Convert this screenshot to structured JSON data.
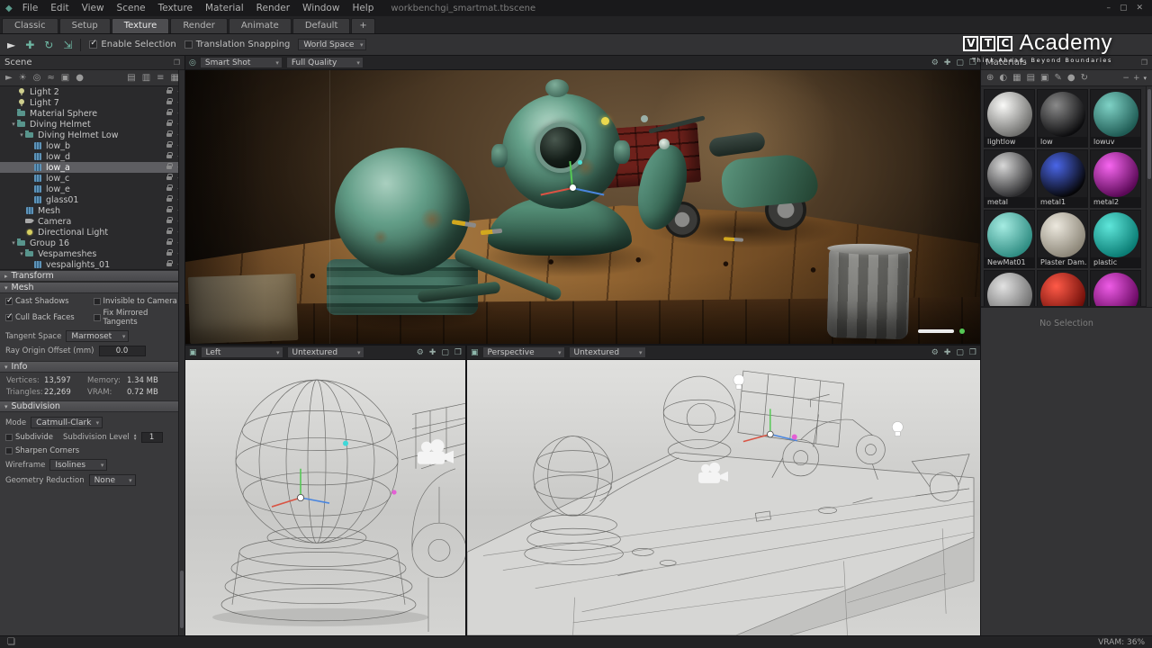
{
  "icons": {
    "app_logo": "◆",
    "camera": "◎",
    "viewport_screen": "▣",
    "performance": "❏",
    "expand_panel": "❐"
  },
  "titlebar": {
    "menus": [
      "File",
      "Edit",
      "View",
      "Scene",
      "Texture",
      "Material",
      "Render",
      "Window",
      "Help"
    ],
    "scene_file": "workbenchgi_smartmat.tbscene",
    "window_controls": [
      {
        "name": "minimize",
        "glyph": "–"
      },
      {
        "name": "maximize",
        "glyph": "▢"
      },
      {
        "name": "close",
        "glyph": "✕"
      }
    ]
  },
  "tabbar": {
    "tabs": [
      "Classic",
      "Setup",
      "Texture",
      "Render",
      "Animate",
      "Default",
      "+"
    ],
    "active": "Texture"
  },
  "toolbar": {
    "tools": [
      {
        "name": "select-tool",
        "glyph": "►"
      },
      {
        "name": "move-tool",
        "glyph": "✚"
      },
      {
        "name": "rotate-tool",
        "glyph": "↻"
      },
      {
        "name": "scale-tool",
        "glyph": "⇲"
      }
    ],
    "enable_selection_label": "Enable Selection",
    "translation_snapping_label": "Translation Snapping",
    "world_space_label": "World Space"
  },
  "brand": {
    "letters": [
      "V",
      "T",
      "C"
    ],
    "name": "Academy",
    "tagline": "Think Ahead, Beyond Boundaries"
  },
  "scene_panel": {
    "title": "Scene",
    "toolbar_left": [
      {
        "name": "select-object",
        "glyph": "►"
      },
      {
        "name": "add-light",
        "glyph": "☀"
      },
      {
        "name": "add-camera",
        "glyph": "◎"
      },
      {
        "name": "add-fog",
        "glyph": "≈"
      },
      {
        "name": "add-object",
        "glyph": "▣"
      },
      {
        "name": "add-sphere",
        "glyph": "●"
      }
    ],
    "toolbar_right": [
      {
        "name": "new-folder",
        "glyph": "▤"
      },
      {
        "name": "delete-item",
        "glyph": "▥"
      },
      {
        "name": "list-view",
        "glyph": "≡"
      },
      {
        "name": "grid-view",
        "glyph": "▦"
      }
    ],
    "tree": [
      {
        "label": "Light 2",
        "depth": 1,
        "icon": "light"
      },
      {
        "label": "Light 7",
        "depth": 1,
        "icon": "light"
      },
      {
        "label": "Material Sphere",
        "depth": 1,
        "icon": "folder"
      },
      {
        "label": "Diving Helmet",
        "depth": 1,
        "icon": "folder",
        "exp": true
      },
      {
        "label": "Diving Helmet Low",
        "depth": 2,
        "icon": "folder",
        "exp": true
      },
      {
        "label": "low_b",
        "depth": 3,
        "icon": "mesh"
      },
      {
        "label": "low_d",
        "depth": 3,
        "icon": "mesh"
      },
      {
        "label": "low_a",
        "depth": 3,
        "icon": "mesh",
        "selected": true
      },
      {
        "label": "low_c",
        "depth": 3,
        "icon": "mesh"
      },
      {
        "label": "low_e",
        "depth": 3,
        "icon": "mesh"
      },
      {
        "label": "glass01",
        "depth": 3,
        "icon": "mesh"
      },
      {
        "label": "Mesh",
        "depth": 2,
        "icon": "mesh"
      },
      {
        "label": "Camera",
        "depth": 2,
        "icon": "camera"
      },
      {
        "label": "Directional Light",
        "depth": 2,
        "icon": "dirlight"
      },
      {
        "label": "Group 16",
        "depth": 1,
        "icon": "folder",
        "exp": true
      },
      {
        "label": "Vespameshes",
        "depth": 2,
        "icon": "folder",
        "exp": true
      },
      {
        "label": "vespalights_01",
        "depth": 3,
        "icon": "mesh"
      }
    ]
  },
  "transform_section": {
    "title": "Transform"
  },
  "mesh_section": {
    "title": "Mesh",
    "options": [
      {
        "label": "Cast Shadows",
        "checked": true
      },
      {
        "label": "Invisible to Camera",
        "checked": false
      },
      {
        "label": "Cull Back Faces",
        "checked": true
      },
      {
        "label": "Fix Mirrored Tangents",
        "checked": false
      }
    ],
    "tangent_label": "Tangent Space",
    "tangent_value": "Marmoset",
    "ray_label": "Ray Origin Offset (mm)",
    "ray_value": "0.0"
  },
  "info_section": {
    "title": "Info",
    "rows": [
      {
        "k1": "Vertices:",
        "v1": "13,597",
        "k2": "Memory:",
        "v2": "1.34 MB"
      },
      {
        "k1": "Triangles:",
        "v1": "22,269",
        "k2": "VRAM:",
        "v2": "0.72 MB"
      }
    ]
  },
  "subdivision_section": {
    "title": "Subdivision",
    "mode_label": "Mode",
    "mode_value": "Catmull-Clark",
    "subdivide_label": "Subdivide",
    "level_label": "Subdivision Level",
    "level_value": "1",
    "sharpen_label": "Sharpen Corners",
    "wireframe_label": "Wireframe",
    "wireframe_value": "Isolines",
    "reduction_label": "Geometry Reduction",
    "reduction_value": "None"
  },
  "viewports": {
    "icons": [
      {
        "name": "render-settings",
        "glyph": "⚙"
      },
      {
        "name": "gizmo-toggle",
        "glyph": "✚"
      },
      {
        "name": "maximize-viewport",
        "glyph": "▢"
      },
      {
        "name": "popout-viewport",
        "glyph": "❐"
      }
    ],
    "main": {
      "camera": "Smart Shot",
      "quality": "Full Quality"
    },
    "left": {
      "view": "Left",
      "shading": "Untextured"
    },
    "perspective": {
      "view": "Perspective",
      "shading": "Untextured"
    }
  },
  "materials_panel": {
    "title": "Materials",
    "toolbar": [
      {
        "name": "new-material",
        "glyph": "⊕"
      },
      {
        "name": "sphere-preview",
        "glyph": "◐"
      },
      {
        "name": "checker-preview",
        "glyph": "▦"
      },
      {
        "name": "material-folder",
        "glyph": "▤"
      },
      {
        "name": "save-material",
        "glyph": "▣"
      },
      {
        "name": "paint-material",
        "glyph": "✎"
      },
      {
        "name": "library",
        "glyph": "●"
      },
      {
        "name": "refresh-materials",
        "glyph": "↻"
      }
    ],
    "zoom_out": "−",
    "zoom_in": "+",
    "items": [
      {
        "name": "lightlow",
        "c1": "#fafaf8",
        "c2": "#6f6f6d"
      },
      {
        "name": "low",
        "c1": "#8a8a8a",
        "c2": "#0c0c0e"
      },
      {
        "name": "lowuv",
        "c1": "#7fd2c6",
        "c2": "#1f5b54"
      },
      {
        "name": "metal",
        "c1": "#d8d8d8",
        "c2": "#2e2e30"
      },
      {
        "name": "metal1",
        "c1": "#4a66e8",
        "c2": "#060608"
      },
      {
        "name": "metal2",
        "c1": "#f766f0",
        "c2": "#5a0856"
      },
      {
        "name": "NewMat01",
        "c1": "#a5ece2",
        "c2": "#2f8c82"
      },
      {
        "name": "Plaster Dam...",
        "c1": "#ece8de",
        "c2": "#8c8678"
      },
      {
        "name": "plastic",
        "c1": "#5fe6da",
        "c2": "#0a7c74"
      },
      {
        "name": "",
        "c1": "#e2e2e2",
        "c2": "#707070"
      },
      {
        "name": "",
        "c1": "#ff5a48",
        "c2": "#6e0e08"
      },
      {
        "name": "",
        "c1": "#ee5ce6",
        "c2": "#66065f"
      }
    ],
    "no_selection": "No Selection"
  },
  "statusbar": {
    "vram": "VRAM: 36%"
  }
}
